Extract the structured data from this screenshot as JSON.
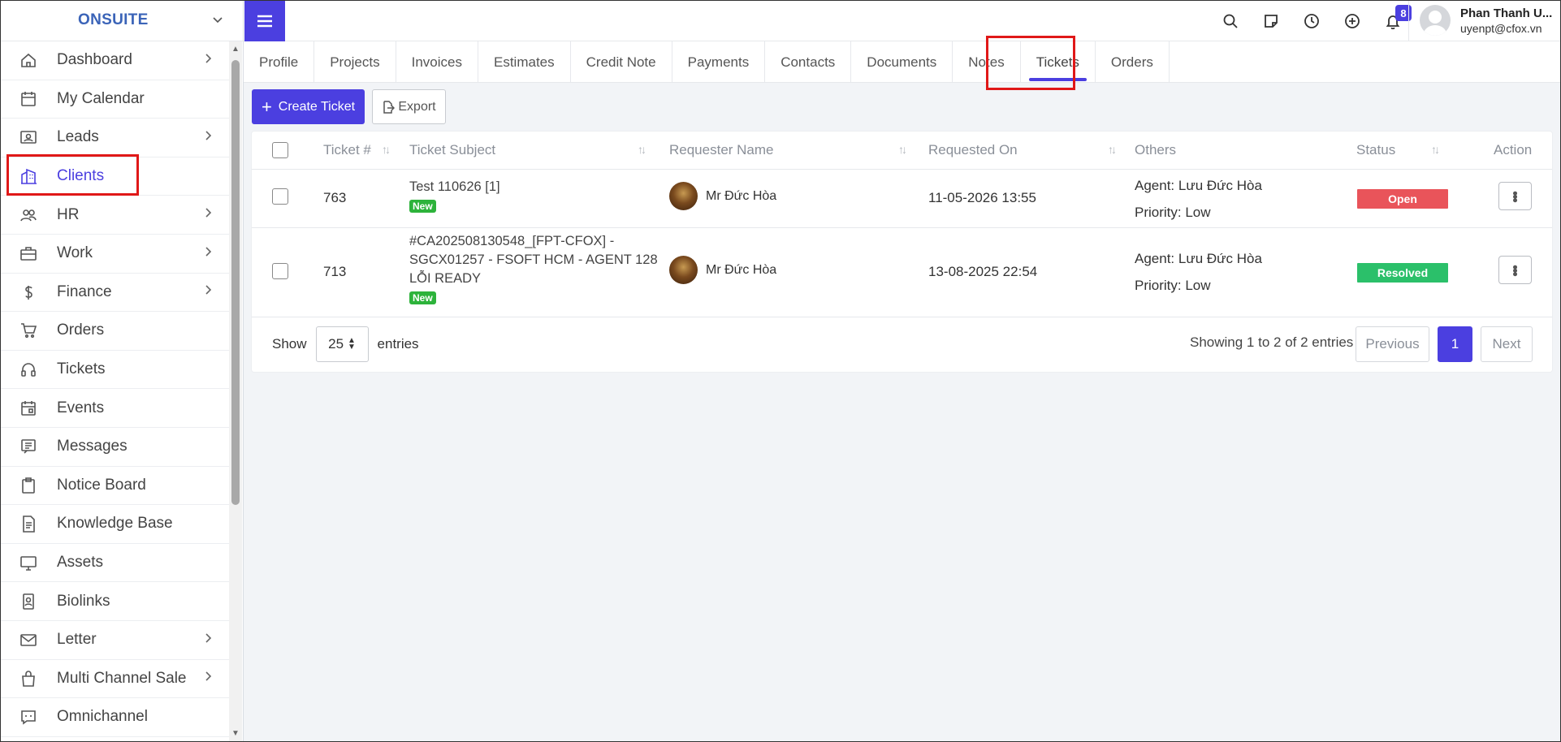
{
  "brand": {
    "name": "ONSUITE"
  },
  "sidebar": {
    "items": [
      {
        "label": "Dashboard",
        "icon": "home-icon",
        "chevron": true
      },
      {
        "label": "My Calendar",
        "icon": "calendar-icon",
        "chevron": false
      },
      {
        "label": "Leads",
        "icon": "id-card-icon",
        "chevron": true
      },
      {
        "label": "Clients",
        "icon": "building-icon",
        "chevron": false,
        "active": true
      },
      {
        "label": "HR",
        "icon": "people-icon",
        "chevron": true
      },
      {
        "label": "Work",
        "icon": "briefcase-icon",
        "chevron": true
      },
      {
        "label": "Finance",
        "icon": "dollar-icon",
        "chevron": true
      },
      {
        "label": "Orders",
        "icon": "cart-icon",
        "chevron": false
      },
      {
        "label": "Tickets",
        "icon": "headset-icon",
        "chevron": false
      },
      {
        "label": "Events",
        "icon": "event-calendar-icon",
        "chevron": false
      },
      {
        "label": "Messages",
        "icon": "message-icon",
        "chevron": false
      },
      {
        "label": "Notice Board",
        "icon": "clipboard-icon",
        "chevron": false
      },
      {
        "label": "Knowledge Base",
        "icon": "document-icon",
        "chevron": false
      },
      {
        "label": "Assets",
        "icon": "monitor-icon",
        "chevron": false
      },
      {
        "label": "Biolinks",
        "icon": "badge-icon",
        "chevron": false
      },
      {
        "label": "Letter",
        "icon": "envelope-icon",
        "chevron": true
      },
      {
        "label": "Multi Channel Sale",
        "icon": "bag-icon",
        "chevron": true
      },
      {
        "label": "Omnichannel",
        "icon": "chat-icon",
        "chevron": false
      }
    ]
  },
  "topbar": {
    "notification_count": "8",
    "user": {
      "name": "Phan Thanh U...",
      "email": "uyenpt@cfox.vn"
    }
  },
  "tabs": [
    {
      "label": "Profile"
    },
    {
      "label": "Projects"
    },
    {
      "label": "Invoices"
    },
    {
      "label": "Estimates"
    },
    {
      "label": "Credit Note"
    },
    {
      "label": "Payments"
    },
    {
      "label": "Contacts"
    },
    {
      "label": "Documents"
    },
    {
      "label": "Notes"
    },
    {
      "label": "Tickets",
      "active": true
    },
    {
      "label": "Orders"
    }
  ],
  "actions": {
    "create_label": "Create Ticket",
    "export_label": "Export"
  },
  "table": {
    "headers": {
      "ticket_no": "Ticket #",
      "subject": "Ticket Subject",
      "requester": "Requester Name",
      "requested_on": "Requested On",
      "others": "Others",
      "status": "Status",
      "action": "Action"
    },
    "rows": [
      {
        "ticket_no": "763",
        "subject_lines": [
          "Test 110626 [1]"
        ],
        "badge": "New",
        "requester": "Mr Đức Hòa",
        "requested_on": "11-05-2026 13:55",
        "agent": "Agent: Lưu Đức Hòa",
        "priority": "Priority: Low",
        "status": "Open",
        "status_color": "#e9545a"
      },
      {
        "ticket_no": "713",
        "subject_lines": [
          "#CA202508130548_[FPT-CFOX] -",
          "SGCX01257 - FSOFT HCM - AGENT 128",
          "LỖI READY"
        ],
        "badge": "New",
        "requester": "Mr Đức Hòa",
        "requested_on": "13-08-2025 22:54",
        "agent": "Agent: Lưu Đức Hòa",
        "priority": "Priority: Low",
        "status": "Resolved",
        "status_color": "#2bc06a"
      }
    ]
  },
  "footer": {
    "show_label": "Show",
    "page_size": "25",
    "entries_label": "entries",
    "info": "Showing 1 to 2 of 2 entries",
    "prev_label": "Previous",
    "current_page": "1",
    "next_label": "Next"
  },
  "colors": {
    "accent": "#4b3fe0",
    "highlight": "#e01818",
    "open": "#e9545a",
    "resolved": "#2bc06a",
    "new_badge": "#2db33b"
  }
}
